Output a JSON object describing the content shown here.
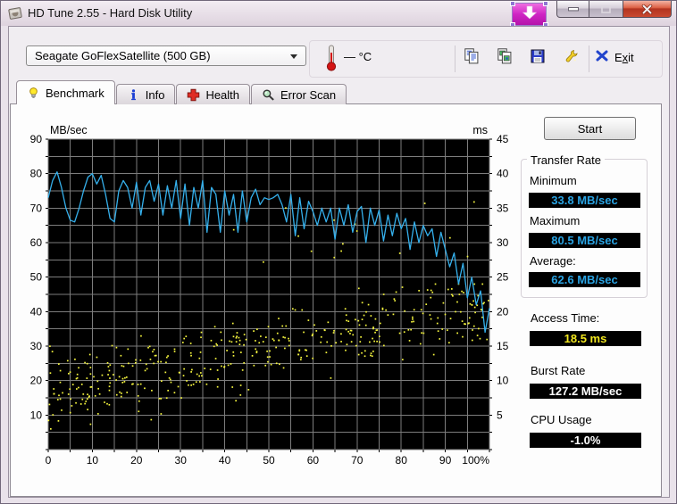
{
  "titlebar": {
    "title": "HD Tune 2.55 - Hard Disk Utility",
    "capture_icon": "download-arrow-icon",
    "minimize_icon": "minimize-icon",
    "maximize_icon": "maximize-icon",
    "close_icon": "close-icon"
  },
  "toolbar": {
    "drive_select_value": "Seagate GoFlexSatellite (500 GB)",
    "temperature_display": "— °C",
    "icons": [
      "copy-text-icon",
      "copy-image-icon",
      "save-icon",
      "options-icon"
    ],
    "exit_pre": "E",
    "exit_underlined": "x",
    "exit_post": "it"
  },
  "tabs": [
    {
      "label": "Benchmark",
      "icon": "lightbulb-icon",
      "active": true
    },
    {
      "label": "Info",
      "icon": "info-icon",
      "active": false
    },
    {
      "label": "Health",
      "icon": "health-cross-icon",
      "active": false
    },
    {
      "label": "Error Scan",
      "icon": "magnifier-icon",
      "active": false
    }
  ],
  "results": {
    "start_label": "Start",
    "transfer_rate": {
      "group_label": "Transfer Rate",
      "minimum_label": "Minimum",
      "minimum_value": "33.8 MB/sec",
      "maximum_label": "Maximum",
      "maximum_value": "80.5 MB/sec",
      "average_label": "Average:",
      "average_value": "62.6 MB/sec"
    },
    "access_time_label": "Access Time:",
    "access_time_value": "18.5 ms",
    "burst_rate_label": "Burst Rate",
    "burst_rate_value": "127.2 MB/sec",
    "cpu_usage_label": "CPU Usage",
    "cpu_usage_value": "-1.0%"
  },
  "chart_data": {
    "type": "line",
    "title": "",
    "left_axis": {
      "label": "MB/sec",
      "min": 0,
      "max": 90,
      "tick_labels": [
        90,
        80,
        70,
        60,
        50,
        40,
        30,
        20,
        10
      ]
    },
    "right_axis": {
      "label": "ms",
      "min": 0,
      "max": 45,
      "tick_labels": [
        45,
        40,
        35,
        30,
        25,
        20,
        15,
        10,
        5
      ]
    },
    "x_axis": {
      "min": 0,
      "max": 100,
      "tick_labels": [
        "0",
        "10",
        "20",
        "30",
        "40",
        "50",
        "60",
        "70",
        "80",
        "90",
        "100%"
      ]
    },
    "grid": true,
    "grid_step_y_units": 5,
    "grid_step_x_percent": 5,
    "colors": {
      "plot_bg": "#000000",
      "grid": "#7d7d7d",
      "line": "#35b0ec",
      "scatter": "#f6f63e"
    },
    "series": [
      {
        "name": "Transfer Rate (MB/sec)",
        "x_start": 0,
        "x_end": 100,
        "values": [
          73,
          78,
          80.5,
          76,
          70,
          66.5,
          66,
          70,
          75,
          79,
          80,
          77,
          79.5,
          74,
          67,
          66,
          75,
          78,
          76,
          70,
          77.5,
          68,
          76,
          78,
          72,
          77,
          68,
          76.5,
          70,
          78,
          67,
          77,
          65,
          76,
          70,
          78,
          63,
          76,
          74,
          63,
          75,
          68,
          74,
          63,
          75,
          66,
          73,
          75.5,
          71,
          73,
          72.5,
          73,
          74,
          71,
          66,
          74,
          62,
          73,
          64,
          72,
          69,
          65,
          70,
          66,
          70,
          61,
          70,
          65,
          71,
          63,
          69,
          70.5,
          60,
          70,
          65,
          69.5,
          60.5,
          68,
          62,
          68.5,
          64,
          67,
          58,
          66,
          60,
          65,
          62,
          64,
          56,
          63,
          58,
          53,
          57,
          48,
          54,
          44,
          50,
          42,
          46,
          34,
          41
        ]
      }
    ],
    "access_time_scatter": {
      "name": "Access Time (ms)",
      "seed": 11,
      "count": 430,
      "ms_trend_start": 8.5,
      "ms_trend_end": 20.5,
      "ms_spread": 5.2,
      "ms_min": 3,
      "ms_max": 24,
      "outlier_count": 16,
      "outlier_ms_min": 26,
      "outlier_ms_max": 37,
      "outlier_x_min": 35
    },
    "summary": {
      "transfer_min_mb_sec": 33.8,
      "transfer_max_mb_sec": 80.5,
      "transfer_avg_mb_sec": 62.6,
      "access_time_ms": 18.5,
      "burst_rate_mb_sec": 127.2,
      "cpu_usage_percent": -1.0
    }
  }
}
